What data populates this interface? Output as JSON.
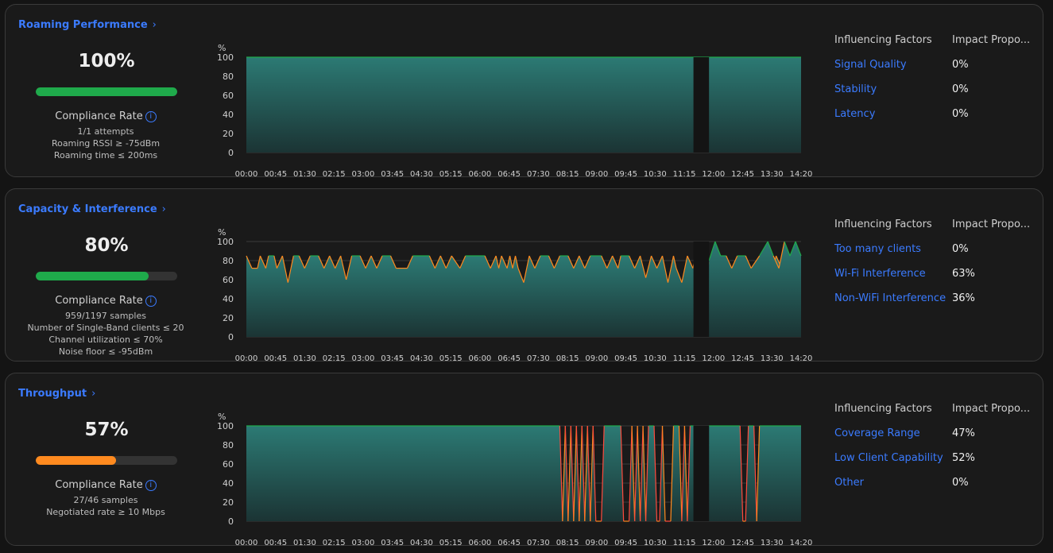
{
  "colors": {
    "accent": "#3b7bff",
    "green": "#1faa4b",
    "orange": "#ff8a1f",
    "threshold": "#ff4a3d",
    "warn": "#ff8a1f"
  },
  "y_axis": {
    "unit": "%",
    "ticks": [
      "100",
      "80",
      "60",
      "40",
      "20",
      "0"
    ]
  },
  "x_axis": {
    "ticks": [
      "00:00",
      "00:45",
      "01:30",
      "02:15",
      "03:00",
      "03:45",
      "04:30",
      "05:15",
      "06:00",
      "06:45",
      "07:30",
      "08:15",
      "09:00",
      "09:45",
      "10:30",
      "11:15",
      "12:00",
      "12:45",
      "13:30",
      "14:20"
    ]
  },
  "panels": [
    {
      "title": "Roaming Performance",
      "chevron": "›",
      "value": "100%",
      "progress": 1.0,
      "bar_color": "#1faa4b",
      "compliance_label": "Compliance Rate",
      "details": [
        "1/1 attempts",
        "Roaming RSSI ≥ -75dBm",
        "Roaming time ≤ 200ms"
      ],
      "factors_header": "Influencing Factors",
      "impact_header": "Impact Propo...",
      "factors": [
        {
          "name": "Signal Quality",
          "value": "0%"
        },
        {
          "name": "Stability",
          "value": "0%"
        },
        {
          "name": "Latency",
          "value": "0%"
        }
      ]
    },
    {
      "title": "Capacity & Interference",
      "chevron": "›",
      "value": "80%",
      "progress": 0.8,
      "bar_color": "#1faa4b",
      "compliance_label": "Compliance Rate",
      "details": [
        "959/1197 samples",
        "Number of Single-Band clients ≤ 20",
        "Channel utilization ≤ 70%",
        "Noise floor ≤ -95dBm"
      ],
      "factors_header": "Influencing Factors",
      "impact_header": "Impact Propo...",
      "factors": [
        {
          "name": "Too many clients",
          "value": "0%"
        },
        {
          "name": "Wi-Fi Interference",
          "value": "63%"
        },
        {
          "name": "Non-WiFi Interference",
          "value": "36%"
        }
      ]
    },
    {
      "title": "Throughput",
      "chevron": "›",
      "value": "57%",
      "progress": 0.57,
      "bar_color": "#ff8a1f",
      "compliance_label": "Compliance Rate",
      "details": [
        "27/46 samples",
        "Negotiated rate ≥ 10 Mbps"
      ],
      "factors_header": "Influencing Factors",
      "impact_header": "Impact Propo...",
      "factors": [
        {
          "name": "Coverage Range",
          "value": "47%"
        },
        {
          "name": "Low Client Capability",
          "value": "52%"
        },
        {
          "name": "Other",
          "value": "0%"
        }
      ]
    }
  ],
  "chart_data": [
    {
      "type": "area",
      "title": "",
      "ylabel": "%",
      "ylim": [
        0,
        100
      ],
      "x_range": [
        "00:00",
        "14:20"
      ],
      "gap": [
        "11:35",
        "12:00"
      ],
      "series": [
        {
          "values": [
            [
              0,
              100
            ],
            [
              0.806,
              100
            ],
            [
              0.834,
              null
            ],
            [
              0.834,
              100
            ],
            [
              1,
              100
            ]
          ]
        }
      ]
    },
    {
      "type": "area",
      "title": "",
      "ylabel": "%",
      "ylim": [
        0,
        100
      ],
      "x_range": [
        "00:00",
        "14:20"
      ],
      "gap": [
        "11:35",
        "12:00"
      ],
      "series": [
        {
          "pattern": "oscillating 65–85",
          "values": [
            [
              0,
              85
            ],
            [
              0.01,
              72
            ],
            [
              0.02,
              72
            ],
            [
              0.025,
              85
            ],
            [
              0.035,
              72
            ],
            [
              0.04,
              85
            ],
            [
              0.05,
              85
            ],
            [
              0.055,
              72
            ],
            [
              0.065,
              85
            ],
            [
              0.075,
              57
            ],
            [
              0.085,
              85
            ],
            [
              0.095,
              85
            ],
            [
              0.105,
              72
            ],
            [
              0.115,
              85
            ],
            [
              0.13,
              85
            ],
            [
              0.14,
              72
            ],
            [
              0.15,
              85
            ],
            [
              0.16,
              72
            ],
            [
              0.17,
              85
            ],
            [
              0.18,
              60
            ],
            [
              0.19,
              85
            ],
            [
              0.205,
              85
            ],
            [
              0.215,
              72
            ],
            [
              0.225,
              85
            ],
            [
              0.235,
              72
            ],
            [
              0.245,
              85
            ],
            [
              0.26,
              85
            ],
            [
              0.27,
              72
            ],
            [
              0.29,
              72
            ],
            [
              0.3,
              85
            ],
            [
              0.33,
              85
            ],
            [
              0.34,
              72
            ],
            [
              0.35,
              85
            ],
            [
              0.36,
              72
            ],
            [
              0.37,
              85
            ],
            [
              0.385,
              72
            ],
            [
              0.395,
              85
            ],
            [
              0.43,
              85
            ],
            [
              0.44,
              72
            ],
            [
              0.45,
              85
            ],
            [
              0.455,
              72
            ],
            [
              0.46,
              85
            ],
            [
              0.47,
              72
            ],
            [
              0.475,
              85
            ],
            [
              0.48,
              72
            ],
            [
              0.485,
              85
            ],
            [
              0.49,
              72
            ],
            [
              0.5,
              57
            ],
            [
              0.51,
              85
            ],
            [
              0.52,
              72
            ],
            [
              0.53,
              85
            ],
            [
              0.545,
              85
            ],
            [
              0.555,
              72
            ],
            [
              0.565,
              85
            ],
            [
              0.58,
              85
            ],
            [
              0.59,
              72
            ],
            [
              0.6,
              85
            ],
            [
              0.61,
              72
            ],
            [
              0.62,
              85
            ],
            [
              0.64,
              85
            ],
            [
              0.65,
              72
            ],
            [
              0.66,
              85
            ],
            [
              0.67,
              72
            ],
            [
              0.675,
              85
            ],
            [
              0.69,
              85
            ],
            [
              0.7,
              72
            ],
            [
              0.71,
              85
            ],
            [
              0.72,
              62
            ],
            [
              0.73,
              85
            ],
            [
              0.74,
              72
            ],
            [
              0.75,
              85
            ],
            [
              0.76,
              57
            ],
            [
              0.77,
              85
            ],
            [
              0.775,
              72
            ],
            [
              0.785,
              57
            ],
            [
              0.795,
              85
            ],
            [
              0.805,
              72
            ],
            [
              0.81,
              85
            ],
            [
              0.815,
              72
            ],
            [
              0.83,
              72
            ],
            [
              0.84,
              85
            ],
            [
              0.85,
              72
            ],
            [
              0.86,
              85
            ],
            [
              0.87,
              72
            ],
            [
              0.88,
              60
            ],
            [
              0.89,
              72
            ],
            [
              0.9,
              85
            ],
            [
              0.91,
              62
            ],
            [
              0.92,
              72
            ],
            [
              0.925,
              85
            ],
            [
              0.94,
              85
            ],
            [
              0.95,
              72
            ],
            [
              0.955,
              85
            ],
            [
              0.965,
              72
            ],
            [
              0.98,
              72
            ]
          ]
        },
        {
          "values": [
            [
              0.834,
              80
            ],
            [
              0.845,
              100
            ],
            [
              0.855,
              85
            ],
            [
              0.865,
              85
            ],
            [
              0.875,
              72
            ],
            [
              0.885,
              85
            ],
            [
              0.9,
              85
            ],
            [
              0.91,
              72
            ],
            [
              0.925,
              85
            ],
            [
              0.94,
              100
            ],
            [
              0.95,
              85
            ],
            [
              0.96,
              72
            ],
            [
              0.97,
              100
            ],
            [
              0.98,
              85
            ],
            [
              0.99,
              100
            ],
            [
              1,
              85
            ]
          ]
        }
      ]
    },
    {
      "type": "area",
      "title": "",
      "ylabel": "%",
      "ylim": [
        0,
        100
      ],
      "x_range": [
        "00:00",
        "14:20"
      ],
      "gap": [
        "11:35",
        "12:00"
      ],
      "series": [
        {
          "values": [
            [
              0,
              100
            ],
            [
              0.565,
              100
            ],
            [
              0.57,
              0
            ],
            [
              0.575,
              100
            ],
            [
              0.58,
              0
            ],
            [
              0.585,
              100
            ],
            [
              0.59,
              0
            ],
            [
              0.595,
              100
            ],
            [
              0.6,
              0
            ],
            [
              0.605,
              100
            ],
            [
              0.61,
              0
            ],
            [
              0.615,
              100
            ],
            [
              0.62,
              0
            ],
            [
              0.625,
              100
            ],
            [
              0.63,
              0
            ],
            [
              0.64,
              0
            ],
            [
              0.645,
              100
            ],
            [
              0.675,
              100
            ],
            [
              0.68,
              0
            ],
            [
              0.69,
              0
            ],
            [
              0.695,
              100
            ],
            [
              0.7,
              0
            ],
            [
              0.705,
              100
            ],
            [
              0.71,
              0
            ],
            [
              0.715,
              100
            ],
            [
              0.72,
              0
            ],
            [
              0.725,
              100
            ],
            [
              0.735,
              100
            ],
            [
              0.74,
              0
            ],
            [
              0.745,
              0
            ],
            [
              0.75,
              100
            ],
            [
              0.755,
              0
            ],
            [
              0.765,
              0
            ],
            [
              0.77,
              100
            ],
            [
              0.78,
              100
            ],
            [
              0.785,
              0
            ],
            [
              0.79,
              100
            ],
            [
              0.795,
              0
            ],
            [
              0.8,
              100
            ],
            [
              0.806,
              100
            ]
          ]
        },
        {
          "values": [
            [
              0.834,
              100
            ],
            [
              0.89,
              100
            ],
            [
              0.895,
              0
            ],
            [
              0.9,
              0
            ],
            [
              0.905,
              100
            ],
            [
              0.915,
              100
            ],
            [
              0.92,
              0
            ],
            [
              0.925,
              100
            ],
            [
              1,
              100
            ]
          ]
        }
      ]
    }
  ]
}
